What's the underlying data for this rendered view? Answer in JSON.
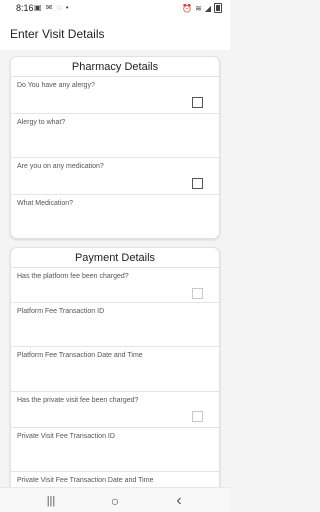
{
  "status_bar": {
    "time": "8:16",
    "left_icons": [
      "app-notification-icon",
      "mail-icon",
      "chat-icon",
      "more-icon"
    ],
    "right_icons": [
      "alarm-icon",
      "wifi-icon",
      "lte-signal-icon",
      "battery-icon"
    ]
  },
  "header": {
    "title": "Enter Visit Details"
  },
  "pharmacy": {
    "title": "Pharmacy Details",
    "fields": [
      {
        "label": "Do You have any alergy?"
      },
      {
        "label": "Alergy to what?"
      },
      {
        "label": "Are you on any medication?"
      },
      {
        "label": "What Medication?"
      }
    ]
  },
  "payment": {
    "title": "Payment Details",
    "fields": [
      {
        "label": "Has the platform fee been charged?"
      },
      {
        "label": "Platform Fee Transaction ID"
      },
      {
        "label": "Platform Fee Transaction Date and Time"
      },
      {
        "label": "Has the private visit fee been charged?"
      },
      {
        "label": "Private Visit Fee Transaction ID"
      },
      {
        "label": "Private Visit Fee Transaction Date and Time"
      }
    ]
  },
  "nav": {
    "recents": "|||",
    "home": "○",
    "back": "‹"
  }
}
